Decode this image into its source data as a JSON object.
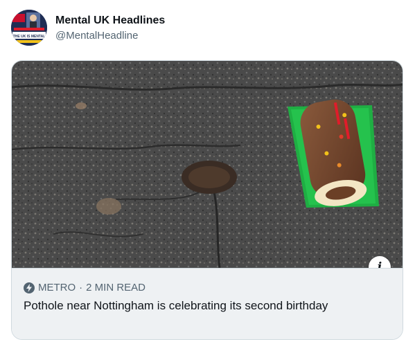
{
  "author": {
    "display_name": "Mental UK Headlines",
    "handle": "@MentalHeadline",
    "avatar_icon": "news-logo-icon",
    "avatar_text": "THE UK IS MENTAL"
  },
  "card": {
    "source": "METRO",
    "separator": "·",
    "read_time": "2 MIN READ",
    "headline": "Pothole near Nottingham is celebrating its second birthday",
    "info_label": "i",
    "image_description_icon": "pothole-photo-icon"
  },
  "colors": {
    "text_primary": "#0f1419",
    "text_secondary": "#536471",
    "card_border": "#cfd9de",
    "footer_bg": "#eef1f3"
  }
}
